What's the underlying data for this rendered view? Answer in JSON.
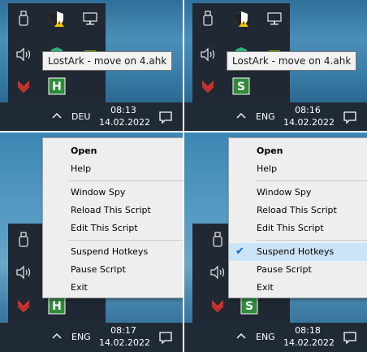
{
  "panels": [
    {
      "lang": "DEU",
      "time": "08:13",
      "date": "14.02.2022",
      "tooltip": "LostArk - move on 4.ahk",
      "ahk_letter": "H"
    },
    {
      "lang": "ENG",
      "time": "08:16",
      "date": "14.02.2022",
      "tooltip": "LostArk - move on 4.ahk",
      "ahk_letter": "S"
    },
    {
      "lang": "ENG",
      "time": "08:17",
      "date": "14.02.2022",
      "ahk_letter": "H"
    },
    {
      "lang": "ENG",
      "time": "08:18",
      "date": "14.02.2022",
      "ahk_letter": "S"
    }
  ],
  "menu": {
    "open": "Open",
    "help": "Help",
    "window_spy": "Window Spy",
    "reload": "Reload This Script",
    "edit": "Edit This Script",
    "suspend": "Suspend Hotkeys",
    "pause": "Pause Script",
    "exit": "Exit",
    "check_mark": "✔"
  },
  "colors": {
    "ahk_icon": "#2f8a3a",
    "defender_shield": "#2fae7a",
    "taskbar": "#202a35",
    "menu_bg": "#eeeeee",
    "checked": "#0a64c8"
  },
  "icons": [
    "usb-icon",
    "security-warning-icon",
    "network-icon",
    "volume-icon",
    "defender-icon",
    "nvidia-icon",
    "download-icon",
    "autohotkey-icon",
    "chevron-up-icon",
    "notification-icon"
  ]
}
